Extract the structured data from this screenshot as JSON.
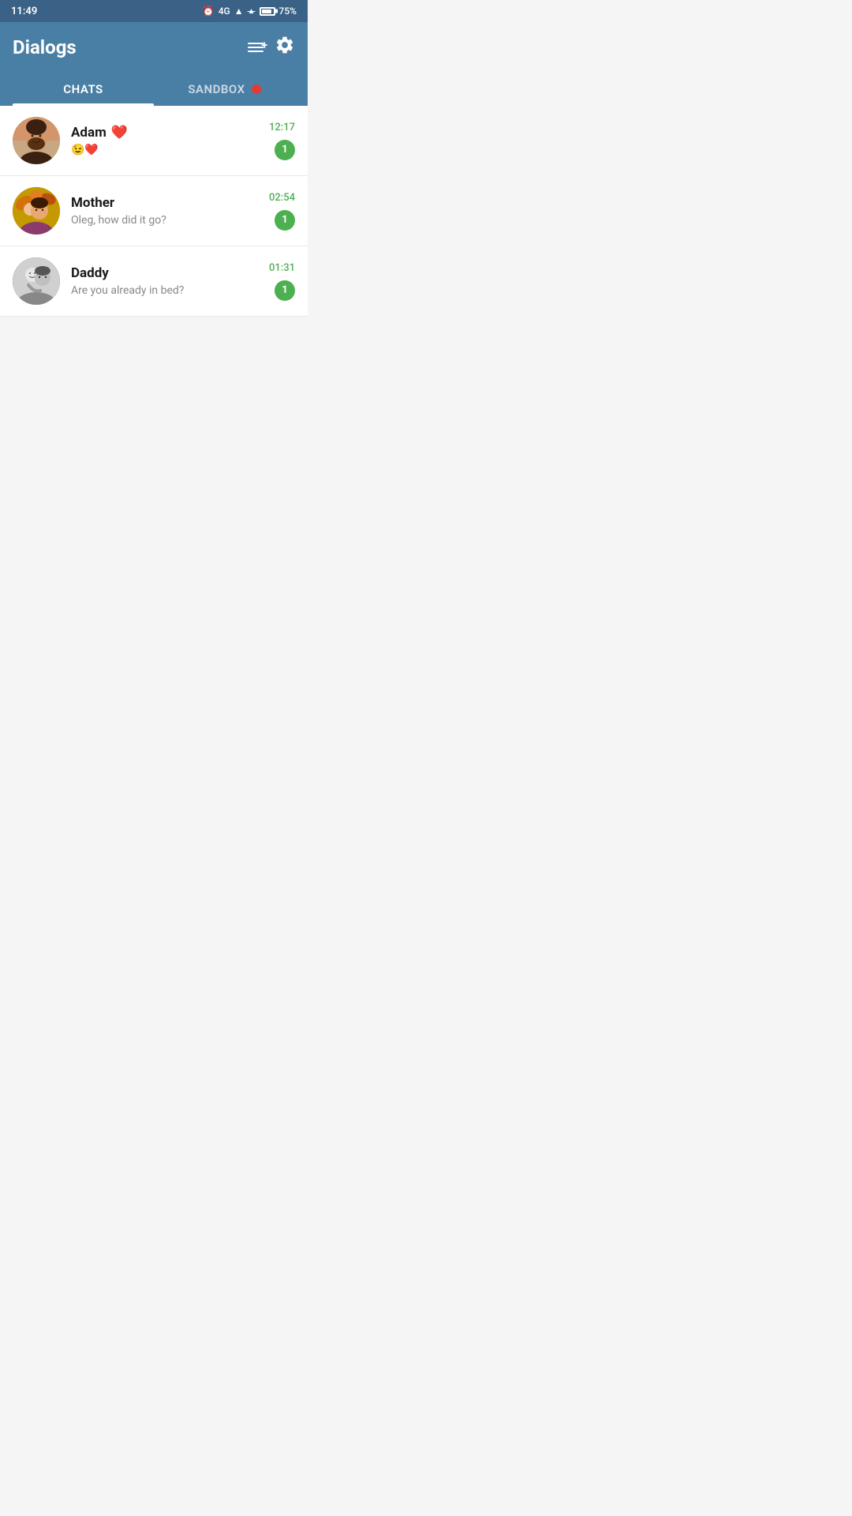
{
  "statusBar": {
    "time": "11:49",
    "network": "4G",
    "battery": "75%"
  },
  "header": {
    "title": "Dialogs",
    "newChatLabel": "new-chat",
    "settingsLabel": "settings"
  },
  "tabs": [
    {
      "id": "chats",
      "label": "CHATS",
      "active": true
    },
    {
      "id": "sandbox",
      "label": "SANDBOX",
      "active": false,
      "hasDot": true
    }
  ],
  "chats": [
    {
      "id": "adam",
      "name": "Adam",
      "nameEmoji": "❤️",
      "preview": "😉❤️",
      "time": "12:17",
      "unread": 1,
      "avatarColor1": "#c8a882",
      "avatarColor2": "#7a4a2a"
    },
    {
      "id": "mother",
      "name": "Mother",
      "preview": "Oleg, how did it go?",
      "time": "02:54",
      "unread": 1,
      "avatarColor1": "#9b7a00",
      "avatarColor2": "#c49a00"
    },
    {
      "id": "daddy",
      "name": "Daddy",
      "preview": "Are you already in bed?",
      "time": "01:31",
      "unread": 1,
      "avatarColor1": "#555555",
      "avatarColor2": "#888888"
    }
  ],
  "colors": {
    "headerBg": "#4a7fa5",
    "statusBarBg": "#3a6186",
    "activeTab": "white",
    "inactiveTab": "rgba(255,255,255,0.6)",
    "unreadBg": "#4caf50",
    "sandboxDot": "#e53935",
    "timeColor": "#4caf50"
  }
}
